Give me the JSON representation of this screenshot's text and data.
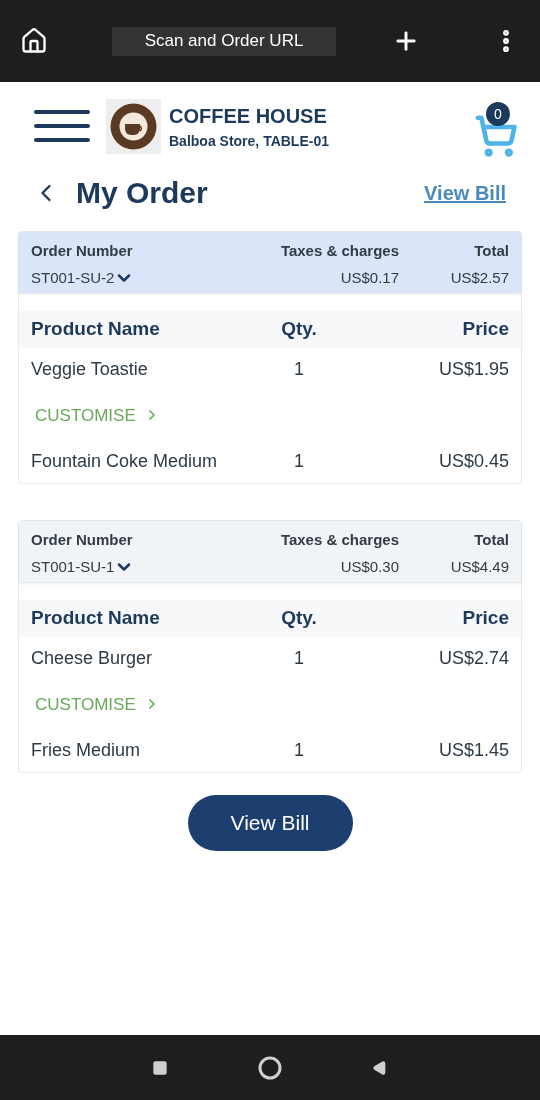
{
  "browser": {
    "url": "Scan and Order URL"
  },
  "header": {
    "store_name": "COFFEE HOUSE",
    "store_location": "Balboa Store, TABLE-01",
    "cart_count": "0"
  },
  "page": {
    "title": "My Order",
    "view_bill_link": "View Bill"
  },
  "orders": [
    {
      "selected": true,
      "number_label": "Order Number",
      "taxes_label": "Taxes & charges",
      "total_label": "Total",
      "number": "ST001-SU-2",
      "taxes": "US$0.17",
      "total": "US$2.57",
      "columns": [
        "Product Name",
        "Qty.",
        "Price"
      ],
      "items": [
        {
          "name": "Veggie Toastie",
          "qty": "1",
          "price": "US$1.95",
          "customise": "CUSTOMISE"
        },
        {
          "name": "Fountain Coke Medium",
          "qty": "1",
          "price": "US$0.45"
        }
      ]
    },
    {
      "selected": false,
      "number_label": "Order Number",
      "taxes_label": "Taxes & charges",
      "total_label": "Total",
      "number": "ST001-SU-1",
      "taxes": "US$0.30",
      "total": "US$4.49",
      "columns": [
        "Product Name",
        "Qty.",
        "Price"
      ],
      "items": [
        {
          "name": "Cheese Burger",
          "qty": "1",
          "price": "US$2.74",
          "customise": "CUSTOMISE"
        },
        {
          "name": "Fries Medium",
          "qty": "1",
          "price": "US$1.45"
        }
      ]
    }
  ],
  "view_bill_button": "View Bill"
}
